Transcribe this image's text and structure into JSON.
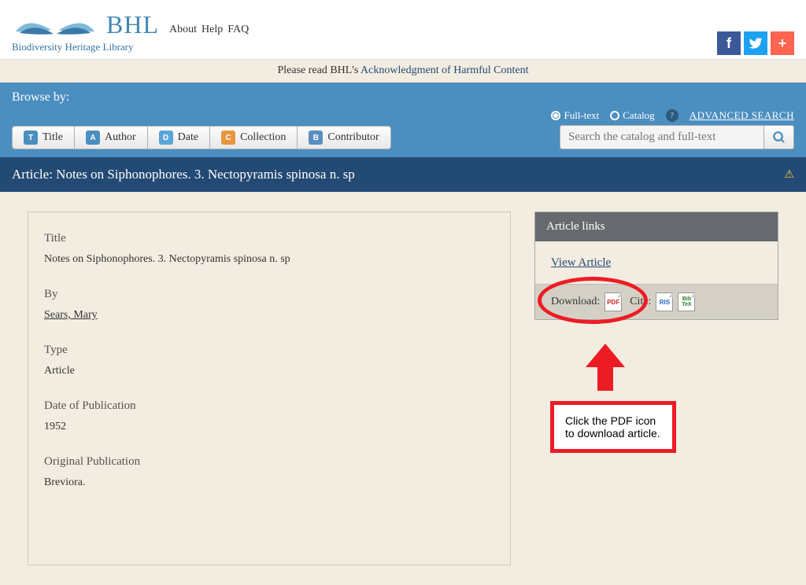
{
  "header": {
    "bhl": "BHL",
    "tagline": "Biodiversity Heritage Library",
    "links": [
      "About",
      "Help",
      "FAQ"
    ]
  },
  "notice": {
    "prefix": "Please read BHL's ",
    "link": "Acknowledgment of Harmful Content"
  },
  "browse": {
    "label": "Browse by:",
    "tabs": [
      {
        "icon": "T",
        "label": "Title"
      },
      {
        "icon": "A",
        "label": "Author"
      },
      {
        "icon": "D",
        "label": "Date"
      },
      {
        "icon": "C",
        "label": "Collection"
      },
      {
        "icon": "B",
        "label": "Contributor"
      }
    ]
  },
  "search": {
    "fulltext_label": "Full-text",
    "catalog_label": "Catalog",
    "advanced": "ADVANCED SEARCH",
    "placeholder": "Search the catalog and full-text"
  },
  "article": {
    "header": "Article: Notes on Siphonophores. 3. Nectopyramis spinosa n. sp",
    "fields": {
      "title_label": "Title",
      "title_value": "Notes on Siphonophores. 3. Nectopyramis spinosa n. sp",
      "by_label": "By",
      "by_value": "Sears, Mary",
      "type_label": "Type",
      "type_value": "Article",
      "date_label": "Date of Publication",
      "date_value": "1952",
      "orig_label": "Original Publication",
      "orig_value": "Breviora."
    }
  },
  "sidebox": {
    "header": "Article links",
    "view": "View Article",
    "download_label": "Download:",
    "cite_label": "Cite:",
    "pdf": "PDF",
    "ris": "RIS",
    "bib": "Bib\nTeX"
  },
  "annotation": {
    "text": "Click the PDF icon to download article."
  }
}
